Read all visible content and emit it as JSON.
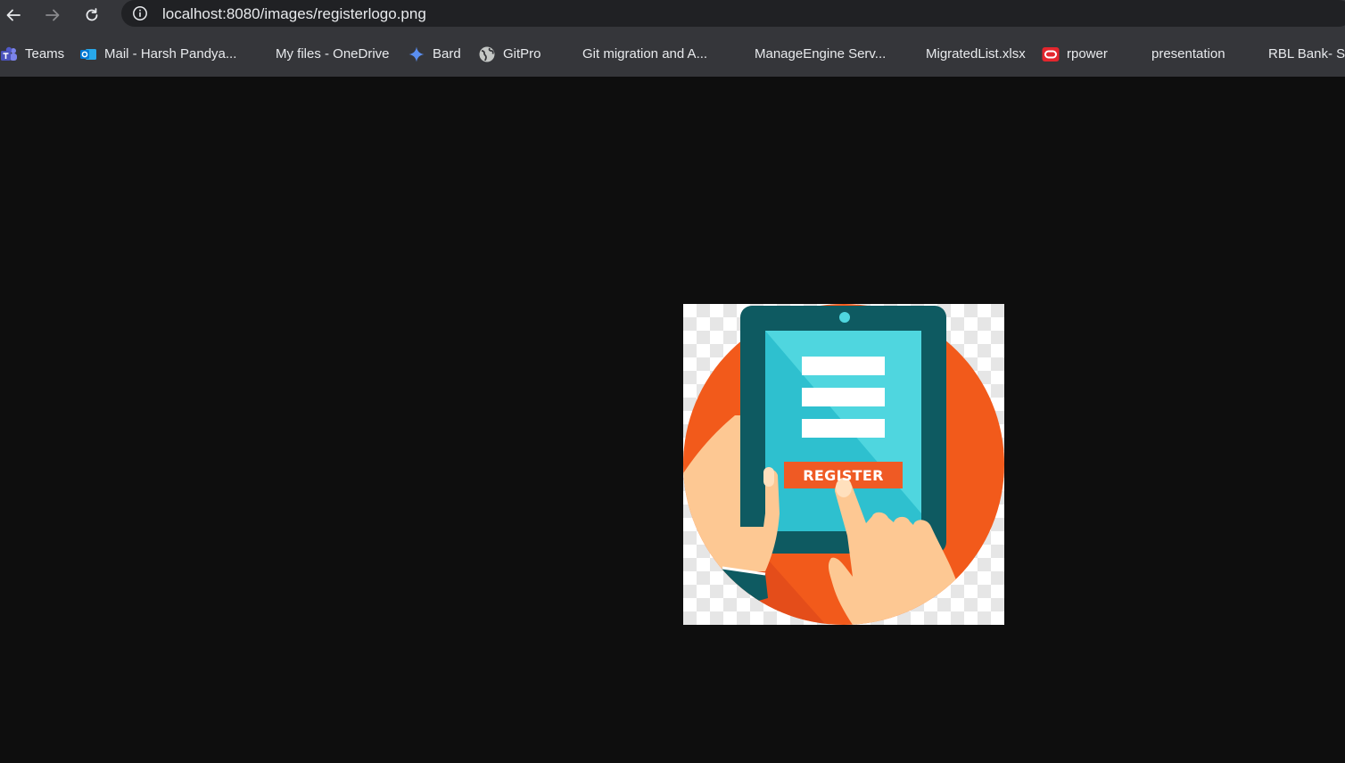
{
  "browser": {
    "url": "localhost:8080/images/registerlogo.png",
    "back_icon": "arrow-left-icon",
    "forward_icon": "arrow-right-icon",
    "reload_icon": "reload-icon",
    "site_info_icon": "info-icon"
  },
  "bookmarks": [
    {
      "label": "Teams",
      "icon": "teams-icon"
    },
    {
      "label": "Mail - Harsh Pandya...",
      "icon": "outlook-icon"
    },
    {
      "label": "My files - OneDrive",
      "icon": "microsoft-icon"
    },
    {
      "label": "Bard",
      "icon": "bard-sparkle-icon"
    },
    {
      "label": "GitPro",
      "icon": "globe-icon"
    },
    {
      "label": "Git migration and A...",
      "icon": "microsoft-icon"
    },
    {
      "label": "ManageEngine Serv...",
      "icon": "microsoft-icon"
    },
    {
      "label": "MigratedList.xlsx",
      "icon": "microsoft-icon"
    },
    {
      "label": "rpower",
      "icon": "oracle-icon"
    },
    {
      "label": "presentation",
      "icon": "microsoft-icon"
    },
    {
      "label": "RBL Bank- St",
      "icon": "microsoft-icon"
    }
  ],
  "image": {
    "button_text": "REGISTER",
    "colors": {
      "circle": "#f25a1b",
      "tablet_frame": "#0e5a61",
      "screen": "#2ec0cf",
      "screen_highlight": "#4fd6df",
      "button": "#ef5a24",
      "skin": "#fdc893"
    }
  }
}
